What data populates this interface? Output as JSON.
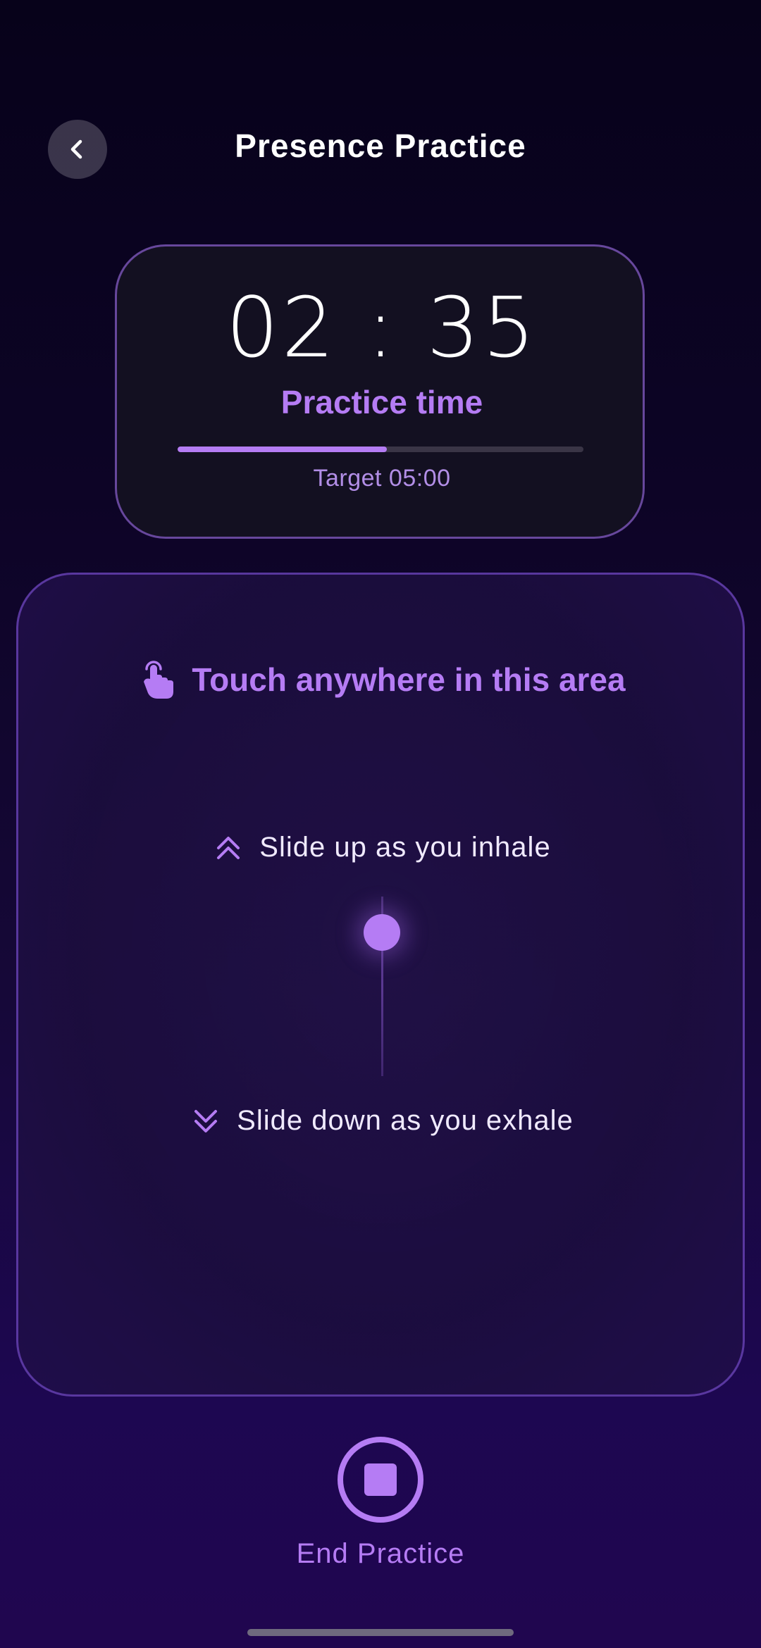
{
  "header": {
    "title": "Presence Practice",
    "back_icon": "chevron-left-icon"
  },
  "timer": {
    "display": "02 : 35",
    "label": "Practice time",
    "target": "Target 05:00",
    "progress": 0.515
  },
  "touch_area": {
    "hint": "Touch anywhere in this area",
    "hint_icon": "tap-finger-icon",
    "inhale_text": "Slide up as you inhale",
    "inhale_icon": "double-chevron-up-icon",
    "exhale_text": "Slide down as you exhale",
    "exhale_icon": "double-chevron-down-icon",
    "slider_position": 0.2
  },
  "footer": {
    "end_label": "End Practice",
    "end_icon": "stop-icon"
  },
  "colors": {
    "accent": "#b57cf4",
    "background_top": "#07021a",
    "background_bottom": "#20064f"
  }
}
